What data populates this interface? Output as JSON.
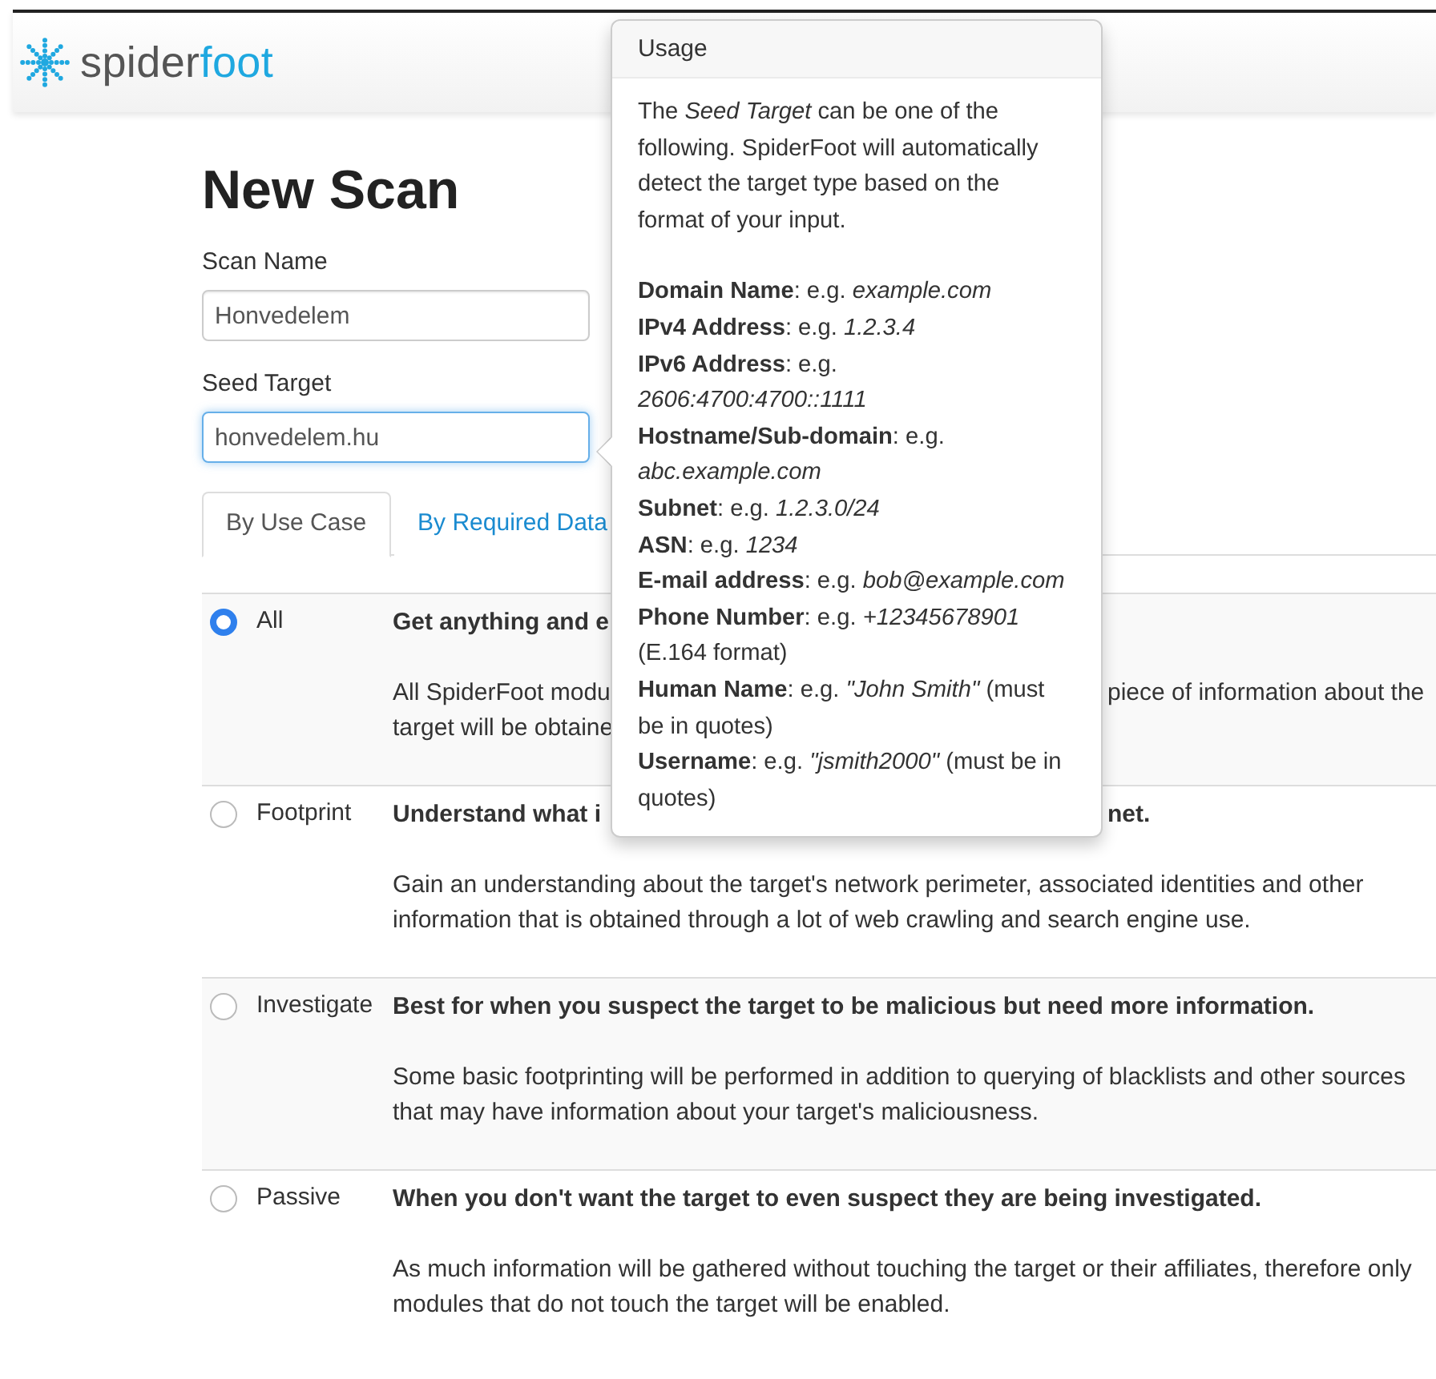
{
  "header": {
    "logo": [
      "spider",
      "foot"
    ]
  },
  "title": "New Scan",
  "fields": [
    {
      "label": "Scan Name",
      "value": "Honvedelem",
      "focused": false
    },
    {
      "label": "Seed Target",
      "value": "honvedelem.hu",
      "focused": true
    }
  ],
  "tabs": [
    {
      "label": "By Use Case",
      "selected": true
    },
    {
      "label": "By Required Data",
      "selected": false
    }
  ],
  "use_cases": [
    {
      "name": "All",
      "selected": true,
      "title": [
        "Get anything and e"
      ],
      "description": [
        [
          "All SpiderFoot modu",
          "piece of information about the"
        ],
        [
          "target will be obtaine"
        ]
      ]
    },
    {
      "name": "Footprint",
      "selected": false,
      "title": [
        "Understand what i",
        "net."
      ],
      "description": [
        [
          "Gain an understanding about the target's network perimeter, associated identities and other"
        ],
        [
          "information that is obtained through a lot of web crawling and search engine use."
        ]
      ]
    },
    {
      "name": "Investigate",
      "selected": false,
      "title": [
        "Best for when you suspect the target to be malicious but need more information."
      ],
      "description": [
        [
          "Some basic footprinting will be performed in addition to querying of blacklists and other sources"
        ],
        [
          "that may have information about your target's maliciousness."
        ]
      ]
    },
    {
      "name": "Passive",
      "selected": false,
      "title": [
        "When you don't want the target to even suspect they are being investigated."
      ],
      "description": [
        [
          "As much information will be gathered without touching the target or their affiliates, therefore only"
        ],
        [
          "modules that do not touch the target will be enabled."
        ]
      ]
    }
  ],
  "popover": {
    "title": "Usage",
    "intro": "The *Seed Target* can be one of the following. SpiderFoot will automatically detect the target type based on the format of your input.",
    "items": [
      "**Domain Name**: e.g. *example.com*",
      "**IPv4 Address**: e.g. *1.2.3.4*",
      "**IPv6 Address**: e.g. *2606:4700:4700::1111*",
      "**Hostname/Sub-domain**: e.g. *abc.example.com*",
      "**Subnet**: e.g. *1.2.3.0/24*",
      "**ASN**: e.g. *1234*",
      "**E-mail address**: e.g. *bob@example.com*",
      "**Phone Number**: e.g. *+12345678901* (E.164 format)",
      "**Human Name**: e.g. *\"John Smith\"* (must be in quotes)",
      "**Username**: e.g. *\"jsmith2000\"* (must be in quotes)"
    ]
  }
}
